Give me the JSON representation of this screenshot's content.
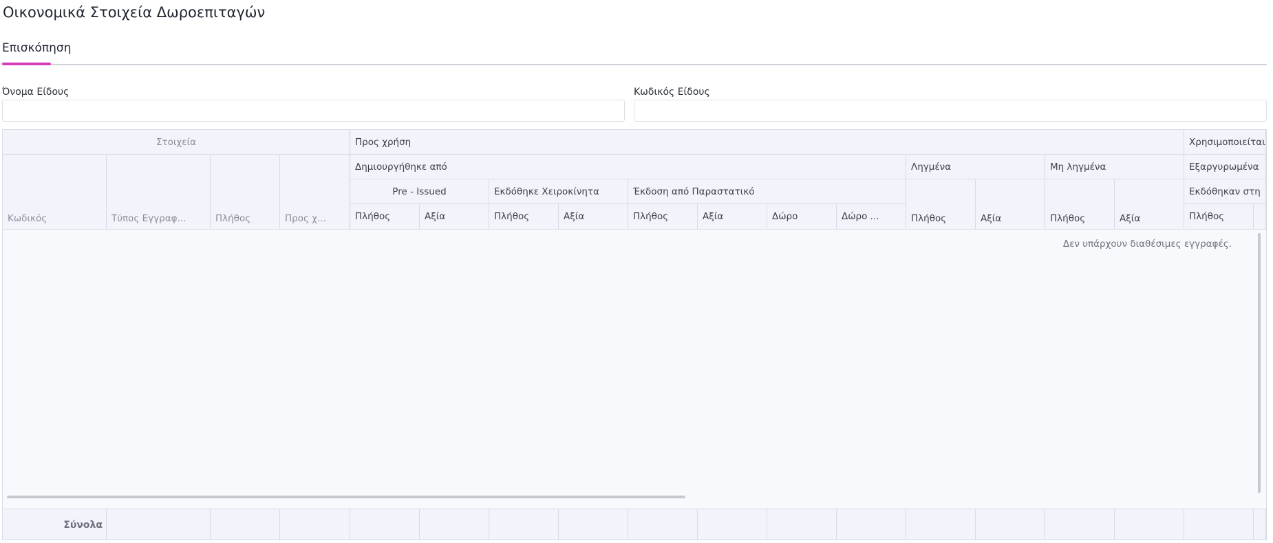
{
  "page": {
    "title": "Οικονομικά Στοιχεία Δωροεπιταγών"
  },
  "tabs": [
    {
      "label": "Επισκόπηση",
      "active": true
    }
  ],
  "filters": {
    "item_name": {
      "label": "Όνομα Είδους",
      "value": "",
      "placeholder": ""
    },
    "item_code": {
      "label": "Κωδικός Είδους",
      "value": "",
      "placeholder": ""
    }
  },
  "grid": {
    "groups": {
      "details": "Στοιχεία",
      "for_use": "Προς χρήση",
      "created_by": "Δημιουργήθηκε από",
      "pre_issued": "Pre - Issued",
      "issued_manually": "Εκδόθηκε Χειροκίνητα",
      "issued_from_document": "Έκδοση από Παραστατικό",
      "expired": "Ληγμένα",
      "not_expired": "Μη ληγμένα",
      "used": "Χρησιμοποιείται",
      "redeemed": "Εξαργυρωμένα",
      "issued_in": "Εκδόθηκαν στη"
    },
    "columns": {
      "code": "Κωδικός",
      "record_type": "Τύπος Εγγραφ...",
      "quantity": "Πλήθος",
      "for_use_short": "Προς χ...",
      "pre_issued_qty": "Πλήθος",
      "pre_issued_value": "Αξία",
      "manual_qty": "Πλήθος",
      "manual_value": "Αξία",
      "doc_qty": "Πλήθος",
      "doc_value": "Αξία",
      "doc_gift": "Δώρο",
      "doc_gift_more": "Δώρο ...",
      "expired_qty": "Πλήθος",
      "expired_value": "Αξία",
      "not_expired_qty": "Πλήθος",
      "not_expired_value": "Αξία",
      "used_qty": "Πλήθος"
    },
    "empty_message": "Δεν υπάρχουν διαθέσιμες εγγραφές.",
    "totals_label": "Σύνολα"
  },
  "colors": {
    "accent": "#d63fb8",
    "header_bg": "#f3f3fb",
    "grid_border": "#d8dbe4"
  }
}
